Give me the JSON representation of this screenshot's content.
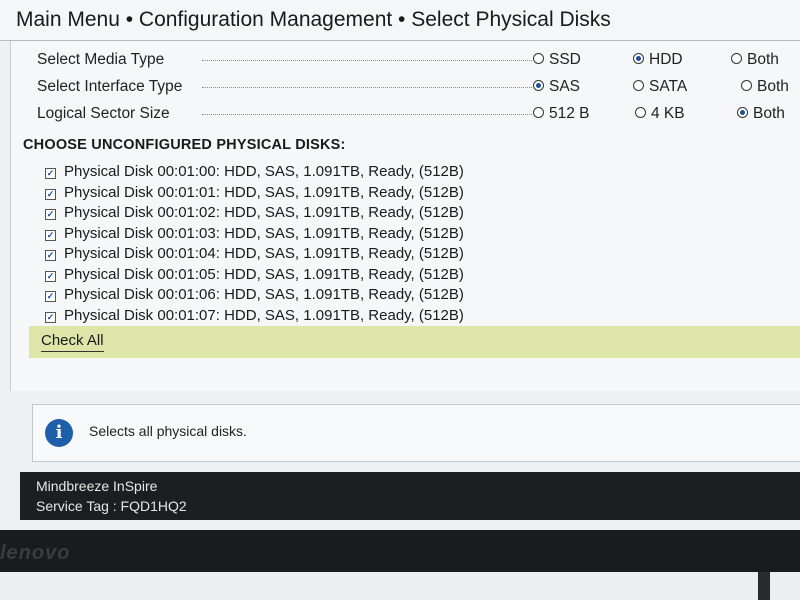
{
  "title": {
    "text": "Main Menu • Configuration Management • Select Physical Disks"
  },
  "options": [
    {
      "label": "Select Media Type",
      "choices": [
        "SSD",
        "HDD",
        "Both"
      ],
      "selected": "HDD"
    },
    {
      "label": "Select Interface Type",
      "choices": [
        "SAS",
        "SATA",
        "Both"
      ],
      "selected": "SAS"
    },
    {
      "label": "Logical Sector Size",
      "choices": [
        "512 B",
        "4 KB",
        "Both"
      ],
      "selected": "Both"
    }
  ],
  "disks": {
    "heading": "CHOOSE UNCONFIGURED PHYSICAL DISKS:",
    "items": [
      {
        "label": "Physical Disk 00:01:00: HDD, SAS, 1.091TB, Ready, (512B)",
        "checked": true
      },
      {
        "label": "Physical Disk 00:01:01: HDD, SAS, 1.091TB, Ready, (512B)",
        "checked": true
      },
      {
        "label": "Physical Disk 00:01:02: HDD, SAS, 1.091TB, Ready, (512B)",
        "checked": true
      },
      {
        "label": "Physical Disk 00:01:03: HDD, SAS, 1.091TB, Ready, (512B)",
        "checked": true
      },
      {
        "label": "Physical Disk 00:01:04: HDD, SAS, 1.091TB, Ready, (512B)",
        "checked": true
      },
      {
        "label": "Physical Disk 00:01:05: HDD, SAS, 1.091TB, Ready, (512B)",
        "checked": true
      },
      {
        "label": "Physical Disk 00:01:06: HDD, SAS, 1.091TB, Ready, (512B)",
        "checked": true
      },
      {
        "label": "Physical Disk 00:01:07: HDD, SAS, 1.091TB, Ready, (512B)",
        "checked": true
      }
    ],
    "check_all_label": "Check All"
  },
  "help": {
    "icon": "info-icon",
    "text": "Selects all physical disks."
  },
  "footer": {
    "product": "Mindbreeze InSpire",
    "service_tag": "Service Tag : FQD1HQ2"
  },
  "bezel": {
    "logo": "lenovo"
  },
  "colors": {
    "highlight": "#dde6a8",
    "radio_fill": "#1f4f9c",
    "info_icon": "#1d5fa8",
    "footer_bg": "#1c1f22"
  }
}
